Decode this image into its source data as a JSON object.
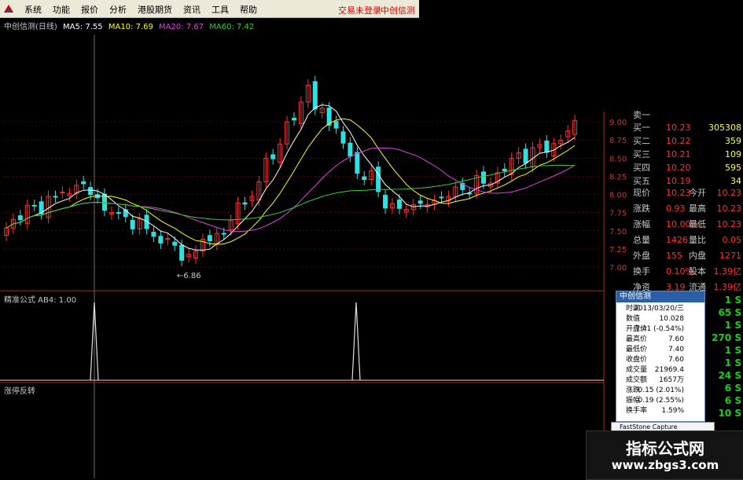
{
  "menubar": {
    "items": [
      "系统",
      "功能",
      "报价",
      "分析",
      "港股期货",
      "资讯",
      "工具",
      "帮助"
    ],
    "trade_status": "交易未登录",
    "brand": "中创信测"
  },
  "chart": {
    "title": "中创信测(日线)",
    "ma5": "MA5: 7.55",
    "ma10": "MA10: 7.69",
    "ma20": "MA20: 7.67",
    "ma60": "MA60: 7.42",
    "low_marker": "6.86",
    "price_axis": [
      "9.00",
      "8.75",
      "8.50",
      "8.25",
      "8.00",
      "7.75",
      "7.50",
      "7.25",
      "7.00"
    ],
    "colors": {
      "up": "#ff3030",
      "down": "#30e0e0",
      "ma5": "#ffffff",
      "ma10": "#ffff00",
      "ma20": "#e040e0",
      "ma60": "#30d030",
      "grid": "#8a1010"
    }
  },
  "indicator1": {
    "label": "精准公式 AB4: 1.00"
  },
  "indicator2": {
    "label": "涨停反转"
  },
  "quote": {
    "top_label": "卖一",
    "bids": [
      {
        "label": "买一",
        "price": "10.23",
        "vol": "305308"
      },
      {
        "label": "买二",
        "price": "10.22",
        "vol": "359"
      },
      {
        "label": "买三",
        "price": "10.21",
        "vol": "109"
      },
      {
        "label": "买四",
        "price": "10.20",
        "vol": "595"
      },
      {
        "label": "买五",
        "price": "10.19",
        "vol": "34"
      }
    ],
    "stats": [
      {
        "l1": "现价",
        "v1": "10.23",
        "l2": "今开",
        "v2": "10.23"
      },
      {
        "l1": "涨跌",
        "v1": "0.93",
        "l2": "最高",
        "v2": "10.23"
      },
      {
        "l1": "涨幅",
        "v1": "10.00%",
        "l2": "最低",
        "v2": "10.23"
      },
      {
        "l1": "总量",
        "v1": "1426",
        "l2": "量比",
        "v2": "0.05"
      },
      {
        "l1": "外盘",
        "v1": "155",
        "l2": "内盘",
        "v2": "1271"
      },
      {
        "l1": "换手",
        "v1": "0.10%",
        "l2": "股本",
        "v2": "1.39亿"
      },
      {
        "l1": "净资",
        "v1": "3.19",
        "l2": "流通",
        "v2": "1.39亿"
      }
    ]
  },
  "popup": {
    "title": "中创信测",
    "rows": [
      {
        "label": "时间",
        "value": "2013/03/20/三"
      },
      {
        "label": "数值",
        "value": "10.028"
      },
      {
        "label": "开盘价",
        "value": "7.41 (-0.54%)"
      },
      {
        "label": "最高价",
        "value": "7.60"
      },
      {
        "label": "最低价",
        "value": "7.40"
      },
      {
        "label": "收盘价",
        "value": "7.60"
      },
      {
        "label": "成交量",
        "value": "21969.4"
      },
      {
        "label": "成交额",
        "value": "1657万"
      },
      {
        "label": "涨跌",
        "value": "0.15 (2.01%)"
      },
      {
        "label": "振幅",
        "value": "0.19 (2.55%)"
      },
      {
        "label": "换手率",
        "value": "1.59%"
      }
    ]
  },
  "right_column": [
    {
      "v": "1",
      "s": "S"
    },
    {
      "v": "65",
      "s": "S"
    },
    {
      "v": "1",
      "s": "S"
    },
    {
      "v": "270",
      "s": "S"
    },
    {
      "v": "1",
      "s": "S"
    },
    {
      "v": "1",
      "s": "S"
    },
    {
      "v": "24",
      "s": "S"
    },
    {
      "v": "6",
      "s": "S"
    },
    {
      "v": "6",
      "s": "S"
    },
    {
      "v": "10",
      "s": "S"
    }
  ],
  "capture_bar": "FastStone Capture",
  "watermark": {
    "line1": "指标公式网",
    "line2": "www.zbgs3.com"
  }
}
